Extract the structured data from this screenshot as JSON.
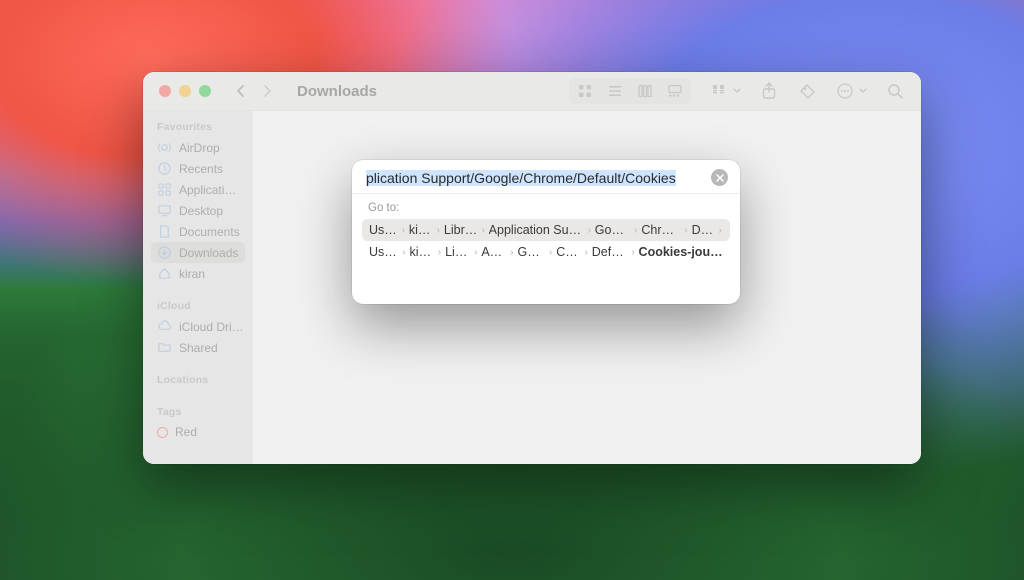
{
  "window": {
    "title": "Downloads"
  },
  "sidebar": {
    "sections": [
      {
        "heading": "Favourites",
        "items": [
          {
            "icon": "airdrop",
            "label": "AirDrop"
          },
          {
            "icon": "clock",
            "label": "Recents"
          },
          {
            "icon": "grid",
            "label": "Applicati…"
          },
          {
            "icon": "desktop",
            "label": "Desktop"
          },
          {
            "icon": "doc",
            "label": "Documents"
          },
          {
            "icon": "download",
            "label": "Downloads",
            "selected": true
          },
          {
            "icon": "home",
            "label": "kiran"
          }
        ]
      },
      {
        "heading": "iCloud",
        "items": [
          {
            "icon": "cloud",
            "label": "iCloud Dri…"
          },
          {
            "icon": "folder",
            "label": "Shared"
          }
        ]
      },
      {
        "heading": "Locations",
        "items": []
      },
      {
        "heading": "Tags",
        "items": [
          {
            "icon": "tag-red",
            "label": "Red"
          }
        ]
      }
    ]
  },
  "goto": {
    "input_value": "plication Support/Google/Chrome/Default/Cookies",
    "section_label": "Go to:",
    "suggestions": [
      {
        "highlight": true,
        "segments": [
          "Users",
          "kiran",
          "Library",
          "Application Support",
          "Google",
          "Chrome",
          "Defa"
        ],
        "bold_last": false,
        "narrow": [
          false,
          true,
          false,
          false,
          false,
          false,
          false
        ]
      },
      {
        "highlight": false,
        "segments": [
          "Users",
          "kiran",
          "Libra",
          "Appli",
          "Goog",
          "Chro",
          "Default",
          "Cookies-journal"
        ],
        "bold_last": true,
        "narrow": [
          false,
          true,
          true,
          true,
          true,
          true,
          false,
          false
        ]
      }
    ]
  }
}
